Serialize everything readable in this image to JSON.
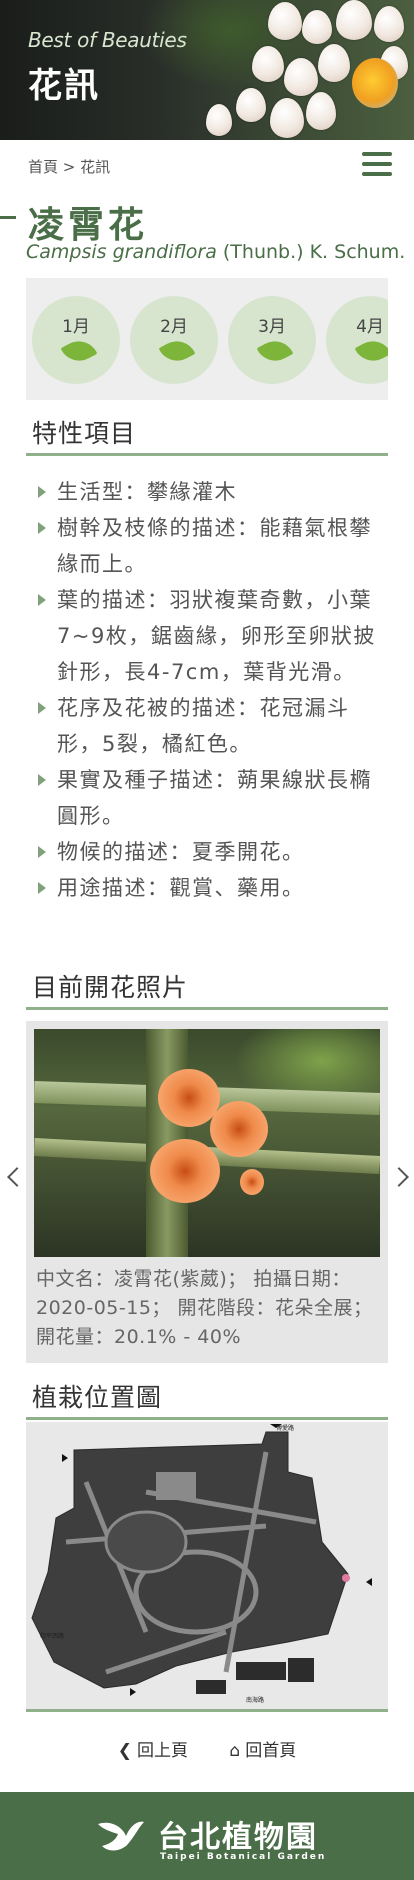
{
  "header": {
    "subtitle": "Best of Beauties",
    "title": "花訊"
  },
  "breadcrumb": {
    "home": "首頁",
    "separator": ">",
    "current": "花訊"
  },
  "plant": {
    "name": "凌霄花",
    "scientific_italic": "Campsis grandiflora",
    "scientific_author": " (Thunb.) K. Schum."
  },
  "months": [
    "1月",
    "2月",
    "3月",
    "4月"
  ],
  "traits": {
    "heading": "特性項目",
    "items": [
      "生活型：攀緣灌木",
      "樹幹及枝條的描述：能藉氣根攀緣而上。",
      "葉的描述：羽狀複葉奇數，小葉7~9枚，鋸齒緣，卵形至卵狀披針形，長4-7cm，葉背光滑。",
      "花序及花被的描述：花冠漏斗形，5裂，橘紅色。",
      "果實及種子描述：蒴果線狀長橢圓形。",
      "物候的描述：夏季開花。",
      "用途描述：觀賞、藥用。"
    ]
  },
  "photos": {
    "heading": "目前開花照片",
    "caption": "中文名：凌霄花(紫葳)； 拍攝日期：2020-05-15； 開花階段：花朵全展；開花量：20.1% - 40%"
  },
  "map": {
    "heading": "植栽位置圖",
    "labels": [
      "博愛路",
      "和平西路",
      "南海路"
    ]
  },
  "nav": {
    "back": "回上頁",
    "home": "回首頁"
  },
  "footer": {
    "logo_name": "台北植物園",
    "logo_en": "Taipei Botanical Garden"
  },
  "colors": {
    "brand_green": "#4a6e47",
    "month_circle": "#d7e5cf",
    "leaf_green": "#7cb53a",
    "section_rule": "#8fb08a"
  }
}
